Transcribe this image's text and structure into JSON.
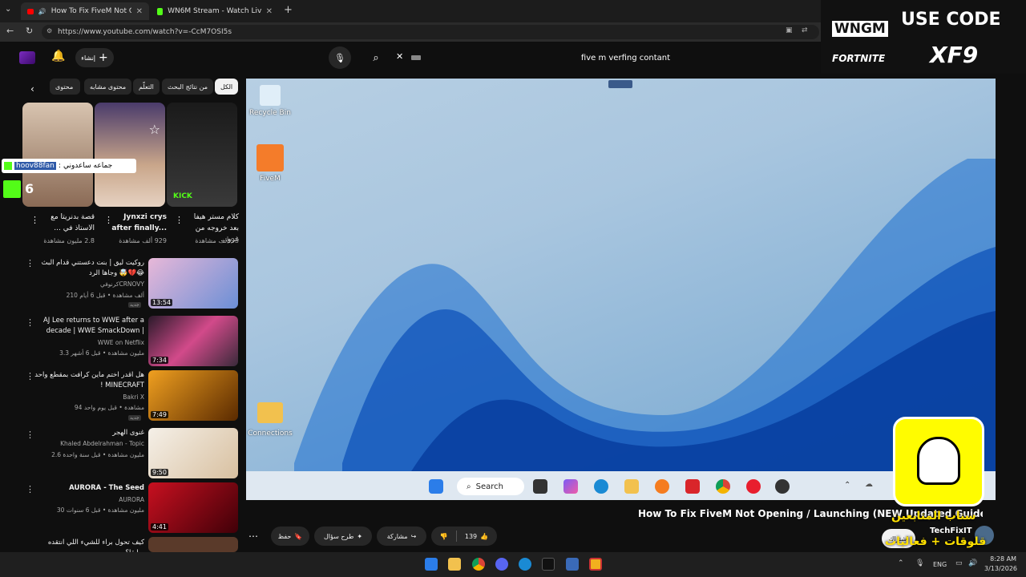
{
  "browser": {
    "tabs": [
      {
        "title": "How To Fix FiveM Not Openin",
        "active": true
      },
      {
        "title": "WN6M Stream - Watch Live on Ki",
        "active": false
      }
    ],
    "url": "https://www.youtube.com/watch?v=-CcM7OSI5s"
  },
  "header": {
    "create_label": "إنشاء",
    "search_value": "five m verfing contant"
  },
  "chips": [
    "الكل",
    "من نتائج البحث",
    "التعلّم",
    "محتوى مشابه",
    "محتوى"
  ],
  "live_overlay": {
    "user": "hoov88fan",
    "message": "جماعه ساعدوني",
    "count": "6"
  },
  "shorts": [
    {
      "title": "كلام مستر هيفا بعد خروجه من غرو...",
      "meta": "93 ألف مشاهدة"
    },
    {
      "title": "Jynxzi crys after finally...",
      "meta": "929 ألف مشاهدة"
    },
    {
      "title": "قصة بدنريتا مع الاستاذ في ...",
      "meta": "2.8 مليون مشاهدة"
    }
  ],
  "videos": [
    {
      "title": "روكيت ليق | بنت دعستني قدام البث وجاها الرد 🤯💔😂",
      "channel": "كرنوفيCRNOVY",
      "meta": "210 ألف مشاهدة • قبل 6 أيام",
      "duration": "13:54",
      "badge": "جديد"
    },
    {
      "title": "AJ Lee returns to WWE after a decade | WWE SmackDown |",
      "channel": "WWE on Netflix",
      "meta": "3.3 مليون مشاهدة • قبل 6 أشهر",
      "duration": "7:34",
      "badge": ""
    },
    {
      "title": "هل اقدر اختم ماين كرافت بمقطع واحد ! MINECRAFT",
      "channel": "Bakri X",
      "meta": "94 مشاهدة • قبل يوم واحد",
      "duration": "7:49",
      "badge": "جديد"
    },
    {
      "title": "غنوى الهجر",
      "channel": "Khaled Abdelrahman - Topic",
      "meta": "2.6 مليون مشاهدة • قبل سنة واحدة",
      "duration": "9:50",
      "badge": ""
    },
    {
      "title": "AURORA - The Seed",
      "channel": "AURORA",
      "meta": "30 مليون مشاهدة • قبل 6 سنوات",
      "duration": "4:41",
      "badge": ""
    },
    {
      "title": "كيف تحول براء للشيء اللي انتقده سابقا؟",
      "channel": "",
      "meta": "",
      "duration": "",
      "badge": ""
    }
  ],
  "desktop": {
    "icons": [
      "Recycle Bin",
      "FiveM",
      "Connections"
    ],
    "search_label": "Search"
  },
  "video": {
    "title": "How To Fix FiveM Not Opening / Launching (NEW Updated Guide 2026)",
    "channel": "TechFixIT",
    "subscribe": "اشتراك",
    "likes": "139",
    "share": "مشاركة",
    "ask": "طرح سؤال",
    "save": "حفظ"
  },
  "promo": {
    "code_label": "USE CODE",
    "brand": "WNGM",
    "game": "FORTNITE",
    "code": "XF9"
  },
  "overlay_text": [
    "سناب المتابعين",
    "قلوقات + فعاليات"
  ],
  "tray": {
    "lang": "ENG",
    "time": "8:28 AM",
    "date": "3/13/2026"
  },
  "colors": {
    "accent": "#ff0000",
    "bg": "#0f0f0f",
    "kick": "#53fc18",
    "snap": "#fffc00"
  }
}
